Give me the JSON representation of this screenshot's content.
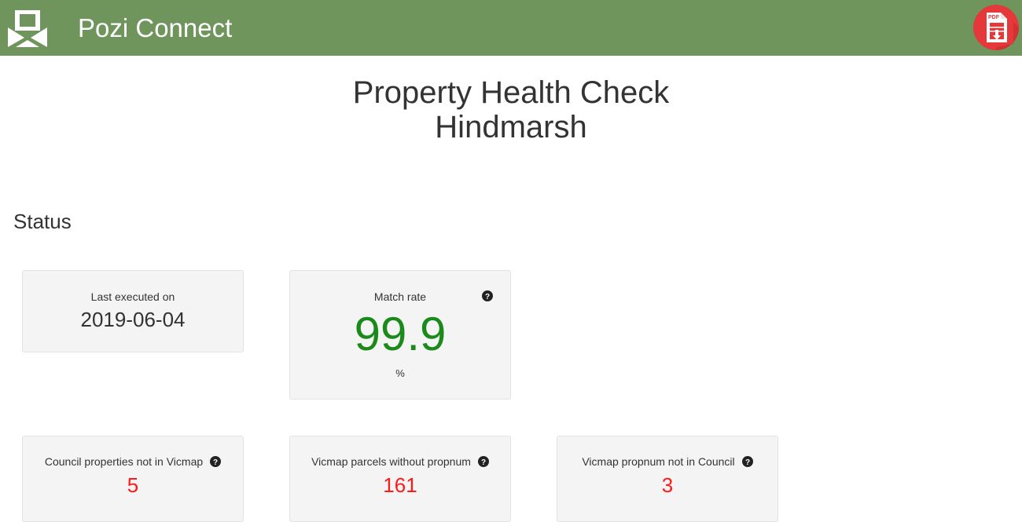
{
  "header": {
    "app_title": "Pozi Connect",
    "logo_icon": "pozi-logo-icon",
    "pdf_button_icon": "pdf-download-icon",
    "colors": {
      "bar": "#6f955c",
      "pdf_button": "#e5383b"
    }
  },
  "page": {
    "title_line1": "Property Health Check",
    "title_line2": "Hindmarsh"
  },
  "status": {
    "heading": "Status",
    "last_executed": {
      "label": "Last executed on",
      "value": "2019-06-04"
    },
    "match_rate": {
      "label": "Match rate",
      "value": "99.9",
      "unit": "%",
      "help_icon": "question-circle-icon",
      "value_color": "#1a8a1a"
    }
  },
  "metrics": [
    {
      "label": "Council properties not in Vicmap",
      "value": "5",
      "help_icon": "question-circle-icon"
    },
    {
      "label": "Vicmap parcels without propnum",
      "value": "161",
      "help_icon": "question-circle-icon"
    },
    {
      "label": "Vicmap propnum not in Council",
      "value": "3",
      "help_icon": "question-circle-icon"
    }
  ],
  "colors": {
    "alert_value": "#ff1a1a"
  }
}
